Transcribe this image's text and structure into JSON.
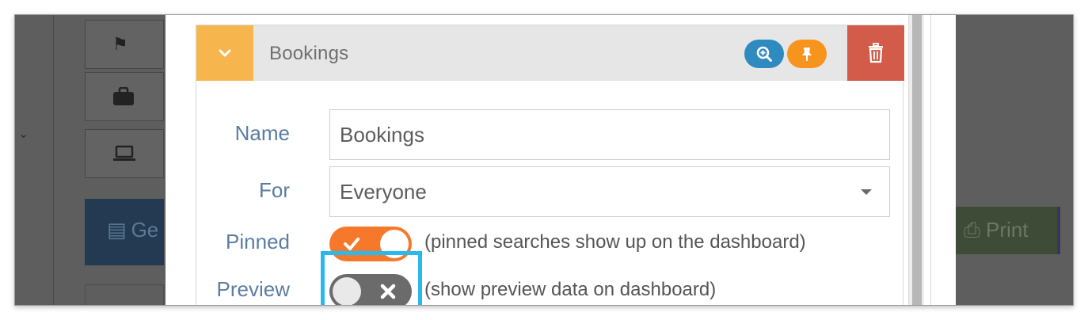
{
  "background": {
    "generate_label": "Ge",
    "print_label": "Print"
  },
  "card": {
    "title": "Bookings",
    "colors": {
      "collapse": "#f7b54d",
      "zoom": "#2f8ac0",
      "pin": "#f7941d",
      "delete": "#d25b4a",
      "toggle_on": "#f6782b",
      "toggle_off": "#6b6b6b",
      "label": "#5a7da3",
      "highlight": "#2ab9ef"
    }
  },
  "form": {
    "name": {
      "label": "Name",
      "value": "Bookings"
    },
    "for": {
      "label": "For",
      "value": "Everyone"
    },
    "pinned": {
      "label": "Pinned",
      "on": true,
      "hint": "(pinned searches show up on the dashboard)"
    },
    "preview": {
      "label": "Preview",
      "on": false,
      "hint": "(show preview data on dashboard)"
    }
  },
  "icons": {
    "collapse": "chevron-down-icon",
    "zoom": "zoom-in-icon",
    "pin": "pin-icon",
    "delete": "trash-icon",
    "toggle_on": "check-icon",
    "toggle_off": "x-icon"
  }
}
